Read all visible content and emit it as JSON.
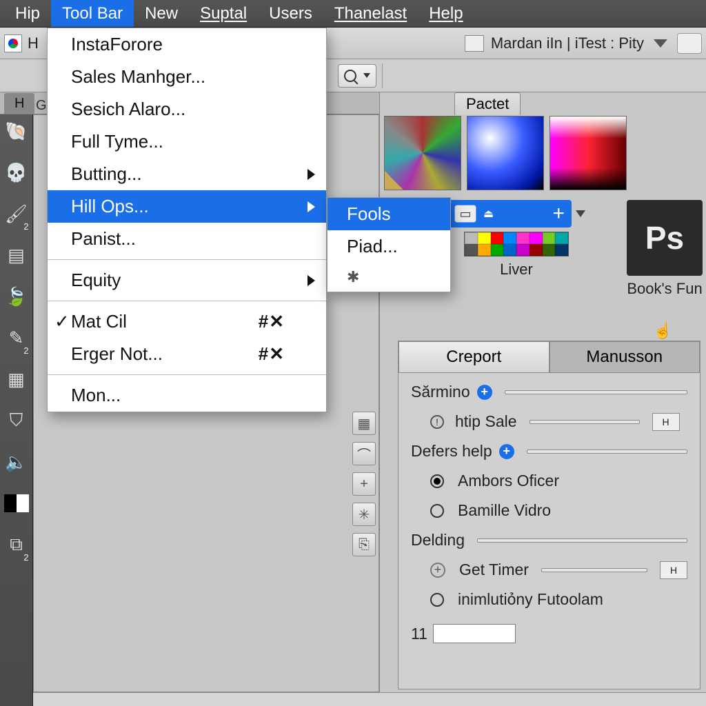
{
  "menubar": {
    "items": [
      "Hip",
      "Tool Bar",
      "New",
      "Suptal",
      "Users",
      "Thanelast",
      "Help"
    ],
    "active_index": 1
  },
  "appbar": {
    "doc_title_left": "H",
    "mode_label": "Mardan iIn  |  iTest  :  Pity"
  },
  "tabrow": {
    "label_dark": "H",
    "label_grop": "Grop"
  },
  "search_button_label": "",
  "pactet_tab": "Pactet",
  "brush_panel": {
    "liver_label": "Liver",
    "books_label": "Book's Fun",
    "ps_logo": "Ps",
    "usb_glyph": "⏏",
    "plus": "+"
  },
  "mini_swatch_colors": [
    "#bbb",
    "#ff0",
    "#f00",
    "#08f",
    "#f3c",
    "#f0f",
    "#7c2",
    "#0aa",
    "#555",
    "#fa0",
    "#0a0",
    "#06c",
    "#c0c",
    "#900",
    "#360",
    "#036"
  ],
  "props": {
    "tabs": [
      "Creport",
      "Manusson"
    ],
    "rows": {
      "sarmino": "Sărmino",
      "htip": "htip Sale",
      "defers": "Defers help",
      "ambors": "Ambors Oficer",
      "bamille": "Bamille Vidro",
      "delding": "Delding",
      "gettimer": "Get Timer",
      "inim": "inimlutiỏny Futoolam",
      "eleven": "11"
    }
  },
  "toolbar_menu": {
    "items": [
      {
        "label": "InstaForore"
      },
      {
        "label": "Sales Manhger..."
      },
      {
        "label": "Sesich Alaro..."
      },
      {
        "label": "Full Tyme..."
      },
      {
        "label": "Butting...",
        "submenu": true
      },
      {
        "label": "Hill Ops...",
        "submenu": true,
        "highlight": true
      },
      {
        "label": "Panist..."
      },
      {
        "sep": true
      },
      {
        "label": "Equity",
        "submenu": true
      },
      {
        "sep": true
      },
      {
        "label": "Mat Cil",
        "checked": true,
        "shortcut": "#✕"
      },
      {
        "label": "Erger Not...",
        "shortcut": "#✕"
      },
      {
        "sep": true
      },
      {
        "label": "Mon..."
      }
    ],
    "submenu": [
      {
        "label": "Fools",
        "highlight": true
      },
      {
        "label": "Piad..."
      },
      {
        "label": "✱",
        "star": true
      }
    ]
  },
  "tool_sub_2": "2",
  "crop_sub": "2"
}
